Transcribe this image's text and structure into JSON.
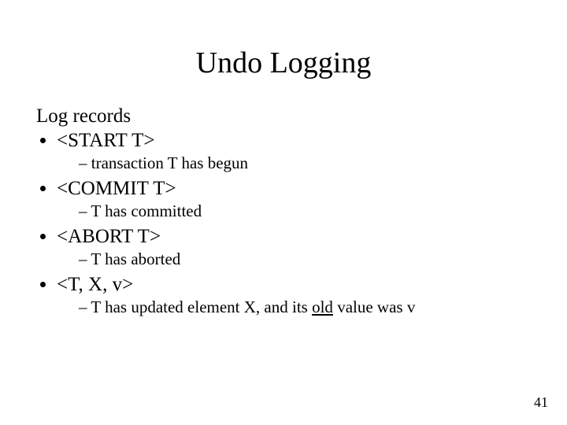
{
  "title": "Undo Logging",
  "lead": "Log records",
  "items": [
    {
      "entry": "<START T>",
      "desc_pre": "transaction T has begun",
      "desc_ul": "",
      "desc_post": ""
    },
    {
      "entry": "<COMMIT T>",
      "desc_pre": "T has committed",
      "desc_ul": "",
      "desc_post": ""
    },
    {
      "entry": "<ABORT T>",
      "desc_pre": "T has aborted",
      "desc_ul": "",
      "desc_post": ""
    },
    {
      "entry": "<T, X, v>",
      "desc_pre": "T has updated element X, and its ",
      "desc_ul": "old",
      "desc_post": " value was v"
    }
  ],
  "page_number": "41"
}
